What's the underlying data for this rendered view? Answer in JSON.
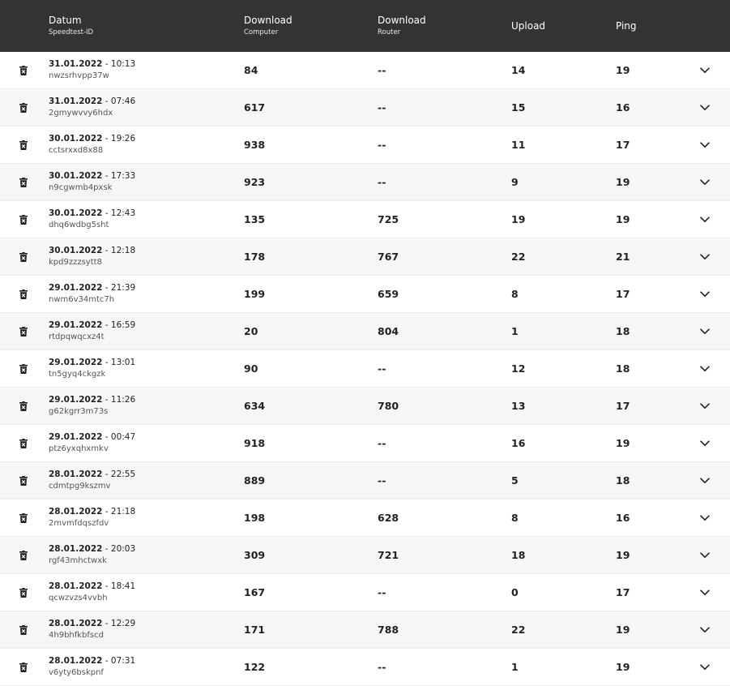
{
  "header": {
    "datum": "Datum",
    "speedtest_id": "Speedtest-ID",
    "download_computer": "Download",
    "download_computer_sub": "Computer",
    "download_router": "Download",
    "download_router_sub": "Router",
    "upload": "Upload",
    "ping": "Ping"
  },
  "icons": {
    "delete": "trash-icon",
    "expand": "chevron-down-icon"
  },
  "colors": {
    "header_bg": "#333333",
    "row_alt_bg": "#f4f6f8",
    "text": "#222222"
  },
  "rows": [
    {
      "date": "31.01.2022",
      "time": "10:13",
      "id": "nwzsrhvpp37w",
      "dc": "84",
      "dr": "--",
      "up": "14",
      "ping": "19"
    },
    {
      "date": "31.01.2022",
      "time": "07:46",
      "id": "2gmywvvy6hdx",
      "dc": "617",
      "dr": "--",
      "up": "15",
      "ping": "16"
    },
    {
      "date": "30.01.2022",
      "time": "19:26",
      "id": "cctsrxxd8x88",
      "dc": "938",
      "dr": "--",
      "up": "11",
      "ping": "17"
    },
    {
      "date": "30.01.2022",
      "time": "17:33",
      "id": "n9cgwmb4pxsk",
      "dc": "923",
      "dr": "--",
      "up": "9",
      "ping": "19"
    },
    {
      "date": "30.01.2022",
      "time": "12:43",
      "id": "dhq6wdbg5sht",
      "dc": "135",
      "dr": "725",
      "up": "19",
      "ping": "19"
    },
    {
      "date": "30.01.2022",
      "time": "12:18",
      "id": "kpd9zzzsytt8",
      "dc": "178",
      "dr": "767",
      "up": "22",
      "ping": "21"
    },
    {
      "date": "29.01.2022",
      "time": "21:39",
      "id": "nwm6v34mtc7h",
      "dc": "199",
      "dr": "659",
      "up": "8",
      "ping": "17"
    },
    {
      "date": "29.01.2022",
      "time": "16:59",
      "id": "rtdpqwqcxz4t",
      "dc": "20",
      "dr": "804",
      "up": "1",
      "ping": "18"
    },
    {
      "date": "29.01.2022",
      "time": "13:01",
      "id": "tn5gyq4ckgzk",
      "dc": "90",
      "dr": "--",
      "up": "12",
      "ping": "18"
    },
    {
      "date": "29.01.2022",
      "time": "11:26",
      "id": "g62kgrr3m73s",
      "dc": "634",
      "dr": "780",
      "up": "13",
      "ping": "17"
    },
    {
      "date": "29.01.2022",
      "time": "00:47",
      "id": "ptz6yxqhxmkv",
      "dc": "918",
      "dr": "--",
      "up": "16",
      "ping": "19"
    },
    {
      "date": "28.01.2022",
      "time": "22:55",
      "id": "cdmtpg9kszmv",
      "dc": "889",
      "dr": "--",
      "up": "5",
      "ping": "18"
    },
    {
      "date": "28.01.2022",
      "time": "21:18",
      "id": "2mvmfdqszfdv",
      "dc": "198",
      "dr": "628",
      "up": "8",
      "ping": "16"
    },
    {
      "date": "28.01.2022",
      "time": "20:03",
      "id": "rgf43mhctwxk",
      "dc": "309",
      "dr": "721",
      "up": "18",
      "ping": "19"
    },
    {
      "date": "28.01.2022",
      "time": "18:41",
      "id": "qcwzvzs4vvbh",
      "dc": "167",
      "dr": "--",
      "up": "0",
      "ping": "17"
    },
    {
      "date": "28.01.2022",
      "time": "12:29",
      "id": "4h9bhfkbfscd",
      "dc": "171",
      "dr": "788",
      "up": "22",
      "ping": "19"
    },
    {
      "date": "28.01.2022",
      "time": "07:31",
      "id": "v6yty6bskpnf",
      "dc": "122",
      "dr": "--",
      "up": "1",
      "ping": "19"
    }
  ]
}
